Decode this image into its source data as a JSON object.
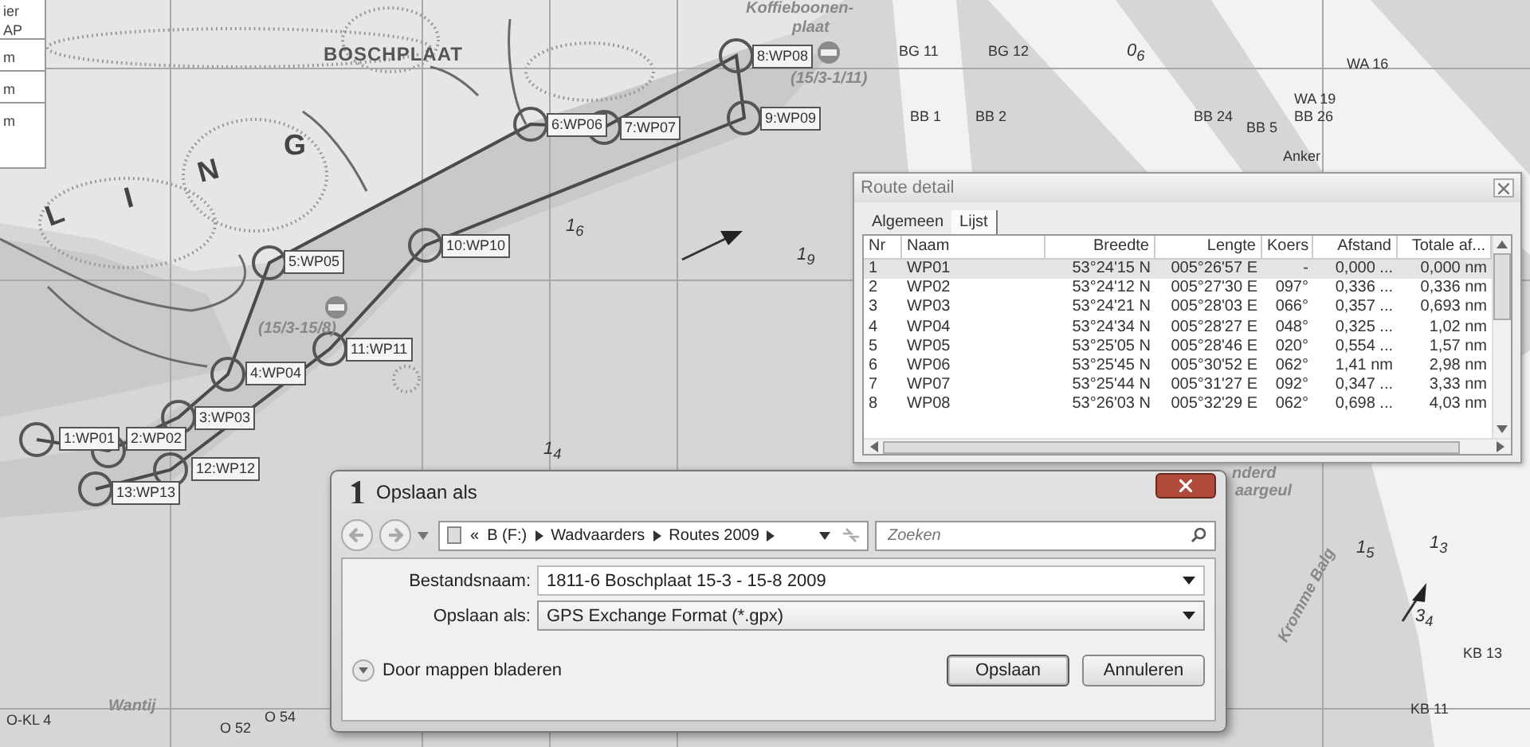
{
  "map": {
    "legend": [
      "ier",
      "AP",
      "m",
      "m",
      "m"
    ],
    "labels": [
      {
        "text": "BOSCHPLAAT",
        "kind": "place"
      },
      {
        "text": "L",
        "kind": "letter"
      },
      {
        "text": "I",
        "kind": "letter"
      },
      {
        "text": "N",
        "kind": "letter"
      },
      {
        "text": "G",
        "kind": "letter"
      },
      {
        "text": "Koffieboonen-",
        "kind": "area"
      },
      {
        "text": "plaat",
        "kind": "area"
      },
      {
        "text": "(15/3-1/11)",
        "kind": "area"
      },
      {
        "text": "BG 11",
        "kind": "buoy"
      },
      {
        "text": "BG 12",
        "kind": "buoy"
      },
      {
        "text": "BB 1",
        "kind": "buoy"
      },
      {
        "text": "BB 2",
        "kind": "buoy"
      },
      {
        "text": "0$_{6}$",
        "kind": "depth"
      },
      {
        "text": "BB 24",
        "kind": "buoy"
      },
      {
        "text": "BB 5",
        "kind": "buoy"
      },
      {
        "text": "WA 19",
        "kind": "buoy"
      },
      {
        "text": "BB 26",
        "kind": "buoy"
      },
      {
        "text": "WA 16",
        "kind": "buoy"
      },
      {
        "text": "Anker",
        "kind": "buoy"
      },
      {
        "text": "(15/3-15/8)",
        "kind": "area"
      },
      {
        "text": "1$_{6}$",
        "kind": "depth"
      },
      {
        "text": "1$_{9}$",
        "kind": "depth"
      },
      {
        "text": "1$_{4}$",
        "kind": "depth"
      },
      {
        "text": "nderd",
        "kind": "area"
      },
      {
        "text": "aargeul",
        "kind": "area"
      },
      {
        "text": "1$_{5}$",
        "kind": "depth"
      },
      {
        "text": "1$_{3}$",
        "kind": "depth"
      },
      {
        "text": "3$_{4}$",
        "kind": "depth"
      },
      {
        "text": "Kromme Balg",
        "kind": "area"
      },
      {
        "text": "KB 13",
        "kind": "buoy"
      },
      {
        "text": "KB 11",
        "kind": "buoy"
      },
      {
        "text": "O-KL 4",
        "kind": "buoy"
      },
      {
        "text": "Wantij",
        "kind": "area"
      },
      {
        "text": "O 52",
        "kind": "buoy"
      },
      {
        "text": "O 54",
        "kind": "buoy"
      }
    ],
    "waypoints": [
      {
        "label": "1:WP01"
      },
      {
        "label": "2:WP02"
      },
      {
        "label": "3:WP03"
      },
      {
        "label": "4:WP04"
      },
      {
        "label": "5:WP05"
      },
      {
        "label": "6:WP06"
      },
      {
        "label": "7:WP07"
      },
      {
        "label": "8:WP08"
      },
      {
        "label": "9:WP09"
      },
      {
        "label": "10:WP10"
      },
      {
        "label": "11:WP11"
      },
      {
        "label": "12:WP12"
      },
      {
        "label": "13:WP13"
      }
    ]
  },
  "route_detail": {
    "title": "Route detail",
    "tabs": [
      {
        "label": "Algemeen",
        "selected": false
      },
      {
        "label": "Lijst",
        "selected": true
      }
    ],
    "columns": [
      "Nr",
      "Naam",
      "Breedte",
      "Lengte",
      "Koers",
      "Afstand",
      "Totale af..."
    ],
    "rows": [
      {
        "cells": [
          "1",
          "WP01",
          "53°24'15 N",
          "005°26'57 E",
          "-",
          "0,000 ...",
          "0,000 nm"
        ],
        "selected": true
      },
      {
        "cells": [
          "2",
          "WP02",
          "53°24'12 N",
          "005°27'30 E",
          "097°",
          "0,336 ...",
          "0,336 nm"
        ],
        "selected": false
      },
      {
        "cells": [
          "3",
          "WP03",
          "53°24'21 N",
          "005°28'03 E",
          "066°",
          "0,357 ...",
          "0,693 nm"
        ],
        "selected": false
      },
      {
        "cells": [
          "4",
          "WP04",
          "53°24'34 N",
          "005°28'27 E",
          "048°",
          "0,325 ...",
          "1,02 nm"
        ],
        "selected": false
      },
      {
        "cells": [
          "5",
          "WP05",
          "53°25'05 N",
          "005°28'46 E",
          "020°",
          "0,554 ...",
          "1,57 nm"
        ],
        "selected": false
      },
      {
        "cells": [
          "6",
          "WP06",
          "53°25'45 N",
          "005°30'52 E",
          "062°",
          "1,41 nm",
          "2,98 nm"
        ],
        "selected": false
      },
      {
        "cells": [
          "7",
          "WP07",
          "53°25'44 N",
          "005°31'27 E",
          "092°",
          "0,347 ...",
          "3,33 nm"
        ],
        "selected": false
      },
      {
        "cells": [
          "8",
          "WP08",
          "53°26'03 N",
          "005°32'29 E",
          "062°",
          "0,698 ...",
          "4,03 nm"
        ],
        "selected": false
      }
    ]
  },
  "save_dialog": {
    "title": "Opslaan als",
    "path_prefix": "«",
    "path": [
      "B (F:)",
      "Wadvaarders",
      "Routes 2009"
    ],
    "search": {
      "placeholder": "Zoeken"
    },
    "fields": [
      {
        "label": "Bestandsnaam:",
        "value": "1811-6 Boschplaat 15-3 - 15-8 2009",
        "kind": "combo"
      },
      {
        "label": "Opslaan als:",
        "value": "GPS Exchange Format (*.gpx)",
        "kind": "select"
      }
    ],
    "browse": "Door mappen bladeren",
    "buttons": [
      {
        "label": "Opslaan",
        "default": true
      },
      {
        "label": "Annuleren",
        "default": false
      }
    ]
  }
}
